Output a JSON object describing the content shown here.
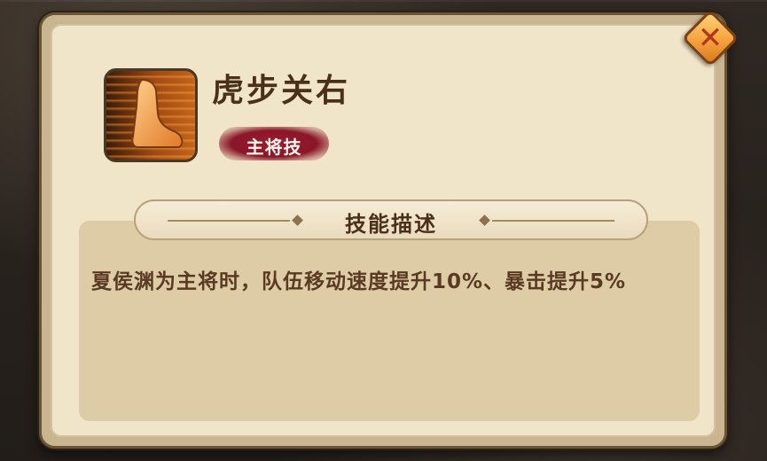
{
  "skill": {
    "name": "虎步关右",
    "tag": "主将技",
    "icon": "running-foot-icon"
  },
  "description": {
    "header": "技能描述",
    "text": "夏侯渊为主将时，队伍移动速度提升10%、暴击提升5%"
  },
  "close_button": {
    "icon": "close-icon",
    "glyph": "✕"
  },
  "colors": {
    "tag_red": "#8a1628",
    "title_brown": "#4a2f1a",
    "close_orange": "#f4a23c"
  }
}
